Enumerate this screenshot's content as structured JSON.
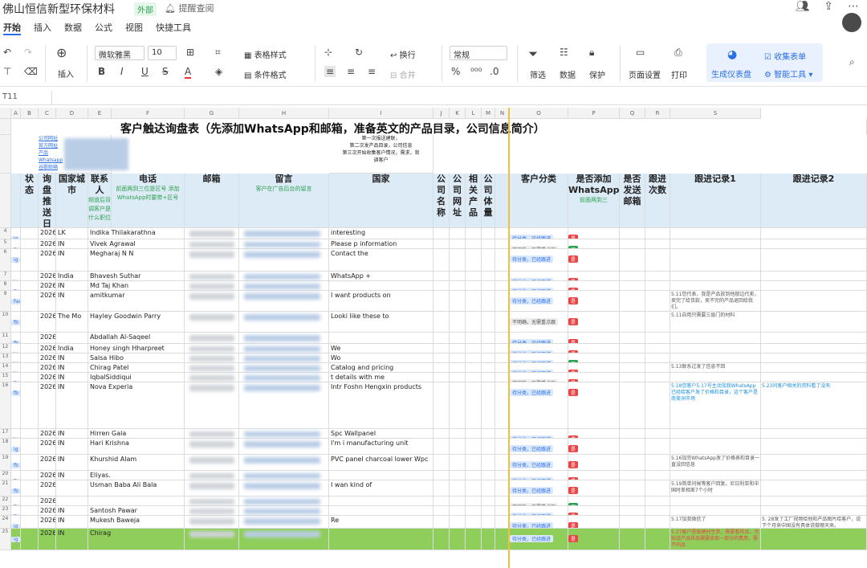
{
  "doc": {
    "title": "佛山恒信新型环保材料",
    "badge": "外部",
    "remind": "提醒查阅"
  },
  "menu": {
    "items": [
      "开始",
      "插入",
      "数据",
      "公式",
      "视图",
      "快捷工具"
    ]
  },
  "ribbon": {
    "insert": "插入",
    "font": "微软雅黑",
    "size": "10",
    "table_style": "表格样式",
    "cond_format": "条件格式",
    "wrap": "换行",
    "merge": "合并",
    "format": "常规",
    "filter": "筛选",
    "data": "数据",
    "protect": "保护",
    "page_setup": "页面设置",
    "print": "打印",
    "gen_panel": "生成仪表盘",
    "collect": "收集表单",
    "smart": "智能工具"
  },
  "fx": {
    "cellref": "T11"
  },
  "sheet": {
    "title": "客户触达询盘表（先添加WhatsApp和邮箱，准备英文的产品目录，公司信息简介）",
    "intro_lines": [
      "第一次报送建联，",
      "第二次发产品目录，公司信息",
      "第三次开始收集客户情况，需求，背",
      "调客户"
    ],
    "left_links": [
      "公司网址",
      "官方网址",
      "产品",
      "Whatsapp",
      "谷歌邮箱"
    ],
    "col_letters": [
      "A",
      "B",
      "C",
      "D",
      "E",
      "F",
      "G",
      "H",
      "I",
      "J",
      "K",
      "L",
      "M",
      "N",
      "O",
      "P",
      "Q",
      "R",
      "S"
    ],
    "headers": {
      "status": "状态",
      "date": "询盘推送日期",
      "country": "国家城市",
      "contact": "联系人",
      "contact_sub": "频道后背调客户是什么职位",
      "phone": "电话",
      "phone_sub": "前面两到三位是区号 添加WhatsApp时要带+区号",
      "email": "邮箱",
      "message": "留言",
      "message_sub": "客户在广告后台的留言",
      "nation": "国家",
      "company": "公司名称",
      "site": "公司网址",
      "product": "相关产品",
      "volume": "公司体量",
      "category": "客户分类",
      "wa": "是否添加WhatsApp",
      "wa_sub": "前面两到三",
      "sent": "是否发送邮箱",
      "times": "跟进次数",
      "f1": "跟进记录1",
      "f2": "跟进记录2"
    },
    "rows": [
      {
        "n": "4",
        "src": "ig",
        "date": "2026/5/7",
        "cty": "LK",
        "name": "Indika Thilakarathna",
        "msg": "interesting",
        "cat": "待分类，已经跟进",
        "wa": "是",
        "f1": "",
        "f2": ""
      },
      {
        "n": "5",
        "src": "Facebo",
        "date": "2026/5/7",
        "cty": "IN",
        "name": "Vivek Agrawal",
        "msg": "Please p          information",
        "cat": "不明确，无需重点跟",
        "wa": "否",
        "f1": "",
        "f2": ""
      },
      {
        "n": "6",
        "src": "ig",
        "date": "2026/5/8",
        "cty": "IN",
        "name": "Megharaj N N",
        "msg": "Contact          the",
        "cat": "待分类，已经跟进",
        "wa": "是",
        "f1": "",
        "f2": ""
      },
      {
        "n": "7",
        "src": "ig",
        "date": "2026/5/8",
        "cty": "India",
        "name": "Bhavesh Suthar",
        "msg": "WhatsApp  +",
        "cat": "待分类，已经跟进",
        "wa": "是",
        "f1": "",
        "f2": ""
      },
      {
        "n": "8",
        "src": "Facebo",
        "date": "2026/5/11",
        "cty": "IN",
        "name": "Md Taj Khan",
        "msg": "",
        "cat": "待分类，已经跟进",
        "wa": "是",
        "f1": "",
        "f2": ""
      },
      {
        "n": "9",
        "src": "Facebo",
        "date": "2026/5/11",
        "cty": "IN",
        "name": "amitkumar",
        "msg": "I want      products on",
        "cat": "待分类，已经跟进",
        "wa": "是",
        "f1": "5.11您代表，我是产品放到他那边代卖，卖完了给货款，卖不完的产品退回给我们。",
        "f2": ""
      },
      {
        "n": "10",
        "src": "fb",
        "date": "2026/5/11",
        "cty": "The Mo",
        "name": "Hayley Goodwin Parry",
        "msg": "Looki       like these to",
        "cat": "不明确，无需重点跟",
        "wa": "是",
        "f1": "5.11自用只需要三扇门的材料",
        "f2": ""
      },
      {
        "n": "11",
        "src": "fb",
        "date": "2026/5/11",
        "cty": "",
        "name": "Abdallah Al-Saqeel",
        "msg": "",
        "cat": "待分类，已经跟进",
        "wa": "是",
        "f1": "",
        "f2": ""
      },
      {
        "n": "12",
        "src": "ig",
        "date": "2026/5/13",
        "cty": "India",
        "name": "Honey singh Hharpreet",
        "msg": "We",
        "cat": "待分类，已经跟进",
        "wa": "是",
        "f1": "",
        "f2": ""
      },
      {
        "n": "13",
        "src": "ig",
        "date": "2026/5/13",
        "cty": "IN",
        "name": "Salsa Hibo",
        "msg": "Wo",
        "cat": "待分类，已经跟进",
        "wa": "否",
        "f1": "",
        "f2": ""
      },
      {
        "n": "14",
        "src": "ig",
        "date": "2026/5/13",
        "cty": "IN",
        "name": "Chirag Patel",
        "msg": "Catalog and pricing",
        "cat": "待分类，已经跟进",
        "wa": "是",
        "f1": "5.13联系过发了信息不回",
        "f2": ""
      },
      {
        "n": "15",
        "src": "fb",
        "date": "2026/5/18",
        "cty": "IN",
        "name": "IqbalSiddiqui",
        "msg": "      t details with me",
        "cat": "不明确，无需重点跟",
        "wa": "是",
        "f1": "",
        "f2": ""
      },
      {
        "n": "16",
        "src": "fb",
        "date": "2026/5/18",
        "cty": "IN",
        "name": "Nova Experia",
        "msg": "Intr        Foshn Hengxin products",
        "cat": "待分类，已经跟进",
        "wa": "是",
        "f1": "5.18您客户5.17号主动加我WhatsApp已经给客户发了价格和目录，这个客户是南美洲市场",
        "f2": "5.23问客户相关的资料看了没有"
      },
      {
        "n": "17",
        "src": "ig",
        "date": "2026/5/18",
        "cty": "IN",
        "name": "Hirren Gala",
        "msg": "Spc Wallpanel",
        "cat": "待分类，已经跟进",
        "wa": "是",
        "f1": "",
        "f2": ""
      },
      {
        "n": "18",
        "src": "ig",
        "date": "2026/5/18",
        "cty": "IN",
        "name": "Hari Krishna",
        "msg": "I'm i       manufacturing unit",
        "cat": "待分类，已经跟进",
        "wa": "是",
        "f1": "",
        "f2": ""
      },
      {
        "n": "19",
        "src": "fb",
        "date": "2026/5/18",
        "cty": "IN",
        "name": "Khurshid Alam",
        "msg": "PVC panel charcoal lower Wpc",
        "cat": "待分类，已经跟进",
        "wa": "是",
        "f1": "5.16加完WhatsApp发了价格表和目录一直没回信息",
        "f2": ""
      },
      {
        "n": "20",
        "src": "fb",
        "date": "2026/5/18",
        "cty": "IN",
        "name": "Eliyas.",
        "msg": "",
        "cat": "待分类，已经跟进",
        "wa": "是",
        "f1": "",
        "f2": ""
      },
      {
        "n": "21",
        "src": "fb",
        "date": "2026/5/19",
        "cty": "",
        "name": "Usman Baba Ali Bala",
        "msg": "I wan        kind of",
        "cat": "待分类，已经跟进",
        "wa": "是",
        "f1": "5.19简单问候等客户回复。尼日利亚和中国时差相差7个小时",
        "f2": ""
      },
      {
        "n": "22",
        "src": "fb",
        "date": "2026/5/19",
        "cty": "",
        "name": "",
        "msg": "",
        "cat": "不明确，无需重点跟",
        "wa": "否",
        "f1": "",
        "f2": ""
      },
      {
        "n": "23",
        "src": "fb",
        "date": "2026/5/23",
        "cty": "IN",
        "name": "Santosh Pawar",
        "msg": "",
        "cat": "待分类，已经跟进",
        "wa": "是",
        "f1": "",
        "f2": ""
      },
      {
        "n": "24",
        "src": "ig",
        "date": "2026/5/23",
        "cty": "IN",
        "name": "Mukesh Baweja",
        "msg": "Re",
        "cat": "待分类，已经跟进",
        "wa": "是",
        "f1": "5.17加我微信了",
        "f2": "5. 28发了工厂视频给他和产品图片给客户，说下个月来中国没有具体说做哪天来。"
      },
      {
        "n": "25",
        "src": "ig",
        "date": "2026/5/27",
        "cty": "IN",
        "name": "Chirag",
        "msg": "",
        "cat": "待分类，已经跟进",
        "wa": "是",
        "f1": "5.27客户是做建材生意，需要看样品，也知道产品样品需要收取一部分的费用，需不同品",
        "f2": ""
      }
    ]
  },
  "colors": {
    "accent": "#2b6fe6",
    "header_bg": "#ddebf7",
    "green": "#2ca24e",
    "red": "#e84545",
    "row_green": "#8fce5a"
  }
}
